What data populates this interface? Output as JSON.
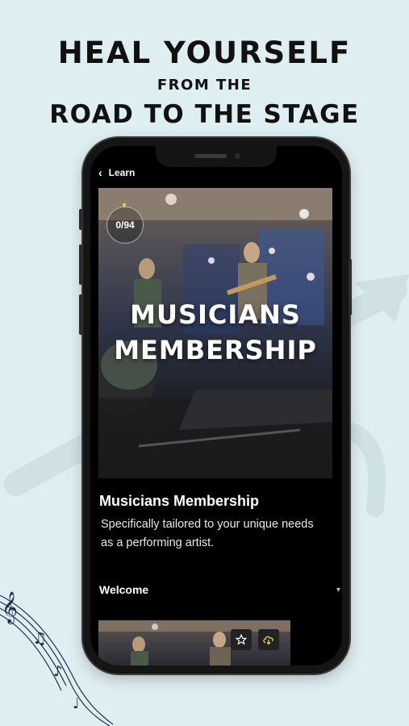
{
  "headline": {
    "line1": "HEAL YOURSELF",
    "line2": "FROM THE",
    "line3": "ROAD TO THE STAGE"
  },
  "app": {
    "back_label": "Learn",
    "hero": {
      "title_line1": "MUSICIANS",
      "title_line2": "MEMBERSHIP"
    },
    "progress_text": "0/94",
    "progress_value": 0,
    "progress_total": 94,
    "course_title": "Musicians Membership",
    "course_description": "Specifically tailored to your unique needs as a performing artist.",
    "section_title": "Welcome",
    "lesson_icons": [
      "star-icon",
      "cloud-download-icon"
    ]
  },
  "colors": {
    "background": "#dfeef1",
    "headline": "#111111",
    "phone_frame": "#151515",
    "screen": "#000000",
    "progress_accent": "#cde35a",
    "download_accent": "#e6d54a"
  }
}
